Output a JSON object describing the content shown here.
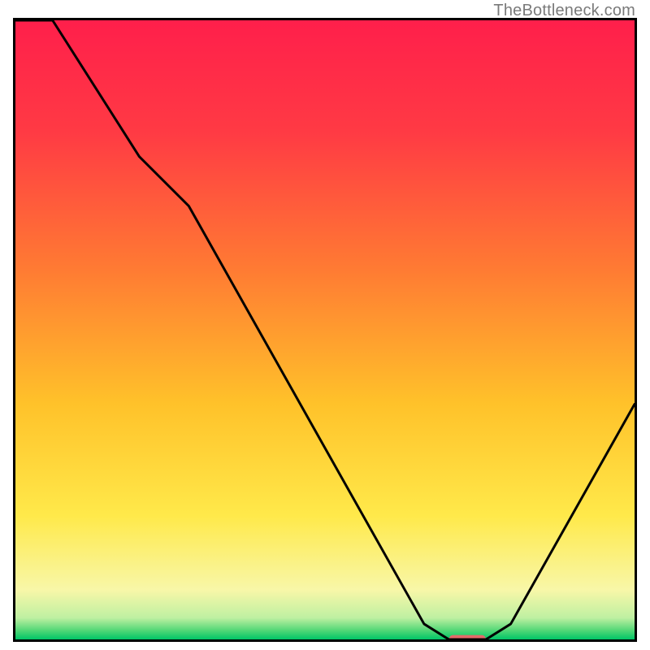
{
  "watermark": "TheBottleneck.com",
  "chart_data": {
    "type": "line",
    "title": "",
    "xlabel": "",
    "ylabel": "",
    "xlim": [
      0,
      100
    ],
    "ylim": [
      0,
      100
    ],
    "grid": false,
    "legend": false,
    "gradient_stops": [
      {
        "offset": 0.0,
        "color": "#ff1f4b"
      },
      {
        "offset": 0.18,
        "color": "#ff3a44"
      },
      {
        "offset": 0.4,
        "color": "#ff7a33"
      },
      {
        "offset": 0.62,
        "color": "#ffc22a"
      },
      {
        "offset": 0.8,
        "color": "#ffe94a"
      },
      {
        "offset": 0.92,
        "color": "#f8f7a8"
      },
      {
        "offset": 0.965,
        "color": "#bff0a2"
      },
      {
        "offset": 0.985,
        "color": "#54d877"
      },
      {
        "offset": 1.0,
        "color": "#00c567"
      }
    ],
    "series": [
      {
        "name": "bottleneck-curve",
        "x": [
          0,
          6,
          20,
          28,
          66,
          70,
          76,
          80,
          100
        ],
        "values": [
          100,
          100,
          78,
          70,
          2.5,
          0,
          0,
          2.5,
          38
        ]
      }
    ],
    "marker": {
      "name": "optimal-marker",
      "x_start": 70,
      "x_end": 76,
      "y": 0,
      "color": "#e46a6a"
    }
  }
}
